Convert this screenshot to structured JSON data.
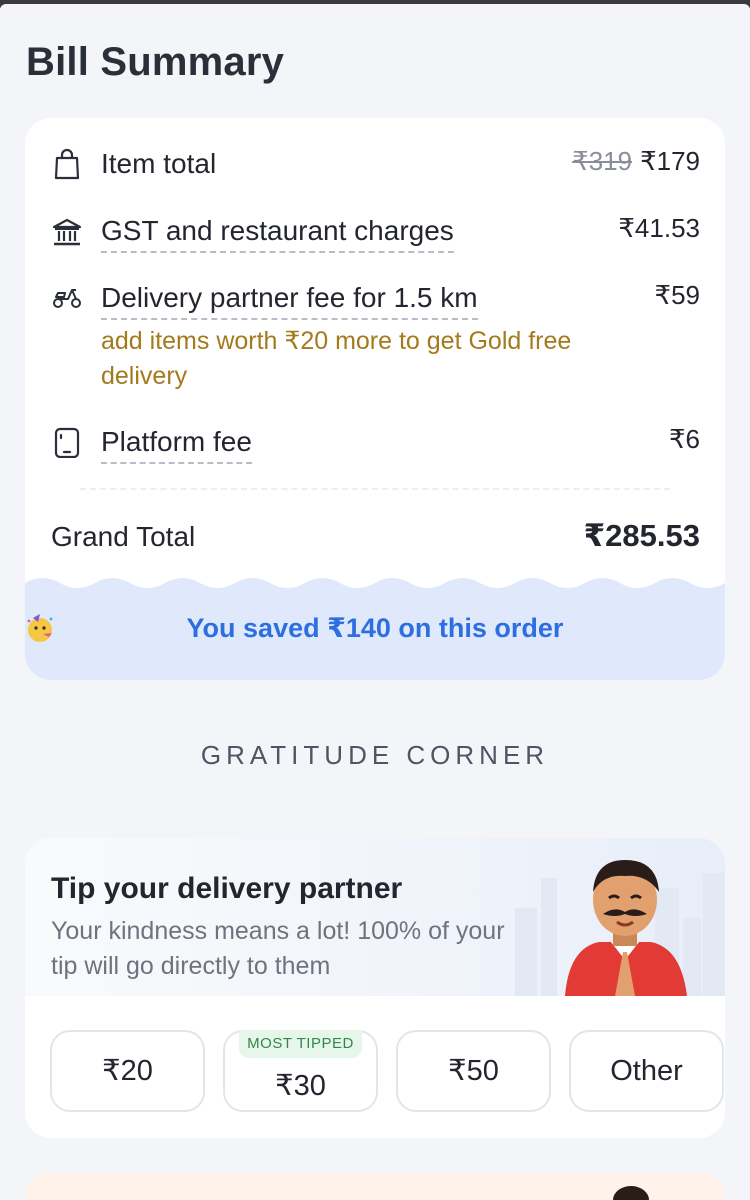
{
  "bill_summary": {
    "title": "Bill Summary",
    "item_total": {
      "label": "Item total",
      "original": "₹319",
      "amount": "₹179"
    },
    "gst": {
      "label": "GST and restaurant charges",
      "amount": "₹41.53"
    },
    "delivery": {
      "label": "Delivery partner fee for 1.5 km",
      "amount": "₹59",
      "note": "add items worth ₹20 more to get Gold free delivery"
    },
    "platform": {
      "label": "Platform fee",
      "amount": "₹6"
    },
    "grand_total": {
      "label": "Grand Total",
      "amount": "₹285.53"
    },
    "savings": "You saved ₹140 on this order"
  },
  "gratitude": {
    "heading": "GRATITUDE CORNER",
    "tip": {
      "title": "Tip your delivery partner",
      "subtitle": "Your kindness means a lot! 100% of your tip will go directly to them",
      "options": [
        {
          "value": "₹20"
        },
        {
          "value": "₹30",
          "tag": "MOST TIPPED"
        },
        {
          "value": "₹50"
        },
        {
          "value": "Other"
        }
      ]
    }
  },
  "colors": {
    "accent_blue": "#2d6ee0",
    "gold": "#a37a1c",
    "savings_bg": "#dfe9fb",
    "tag_green": "#2f8a48"
  },
  "icons": [
    "shopping-bag-icon",
    "bank-icon",
    "scooter-icon",
    "phone-icon",
    "party-face-icon"
  ]
}
